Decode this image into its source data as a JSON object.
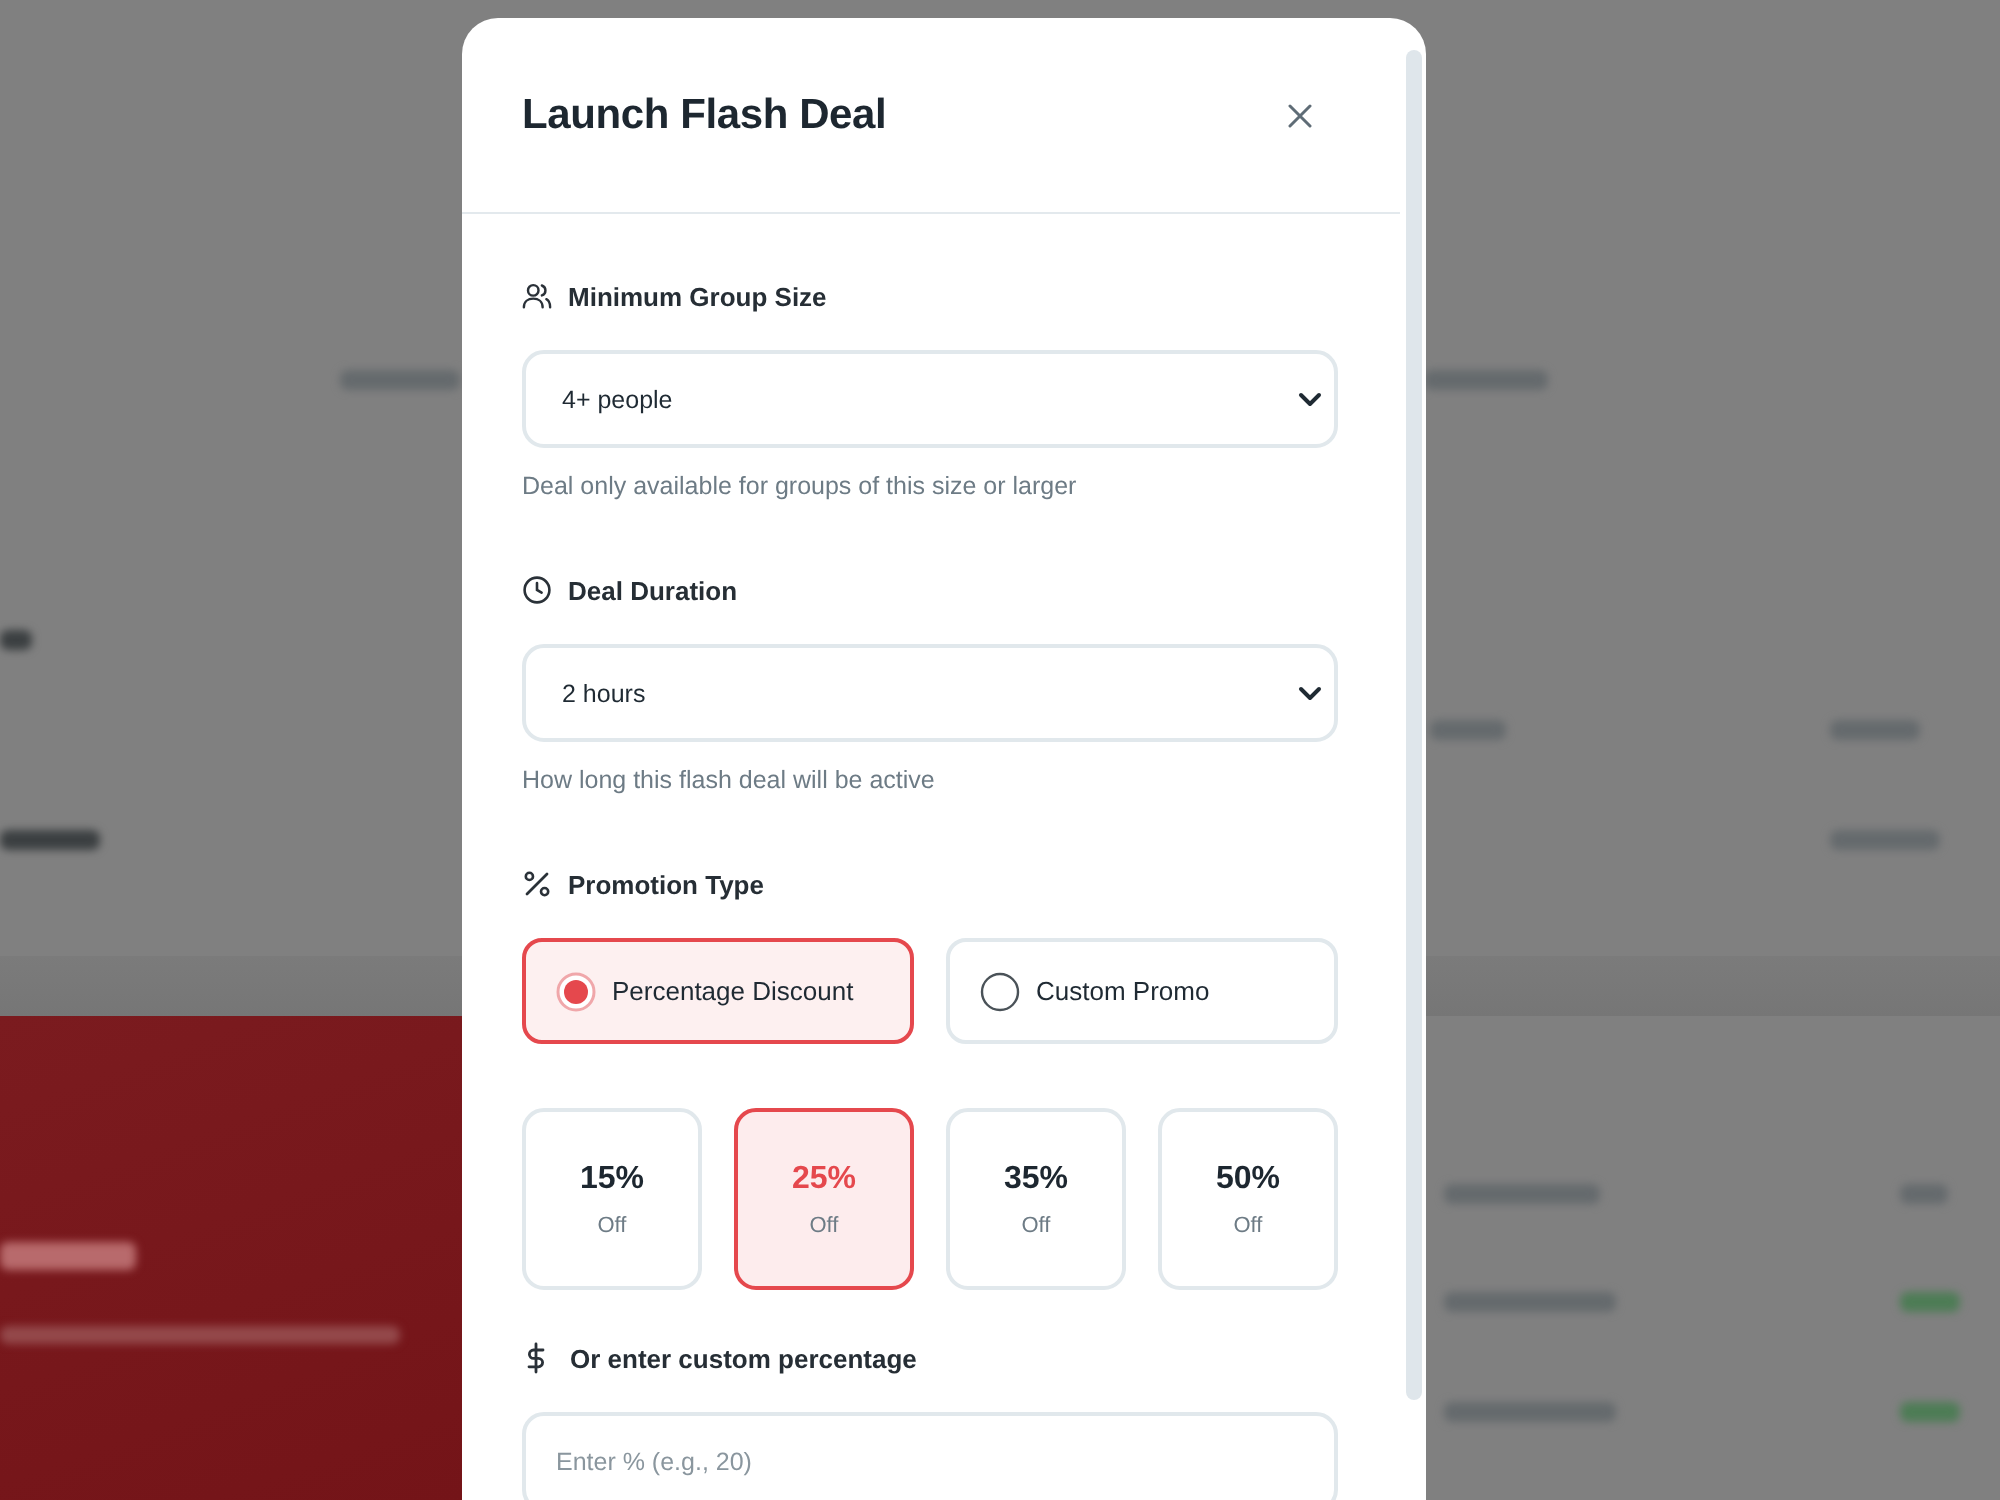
{
  "modal": {
    "title": "Launch Flash Deal"
  },
  "sections": [
    {
      "kind": "select",
      "label": "Minimum Group Size",
      "value": "4+ people",
      "hint": "Deal only available for groups of this size or larger"
    },
    {
      "kind": "select",
      "label": "Deal Duration",
      "value": "2 hours",
      "hint": "How long this flash deal will be active"
    },
    {
      "kind": "choice",
      "label": "Promotion Type",
      "options": [
        {
          "label": "Percentage Discount",
          "selected": true
        },
        {
          "label": "Custom Promo",
          "selected": false
        }
      ],
      "presets": [
        {
          "value": "15%",
          "caption": "Off",
          "selected": false
        },
        {
          "value": "25%",
          "caption": "Off",
          "selected": true
        },
        {
          "value": "35%",
          "caption": "Off",
          "selected": false
        },
        {
          "value": "50%",
          "caption": "Off",
          "selected": false
        }
      ]
    },
    {
      "kind": "input",
      "label": "Or enter custom percentage",
      "placeholder": "Enter % (e.g., 20)"
    }
  ]
}
